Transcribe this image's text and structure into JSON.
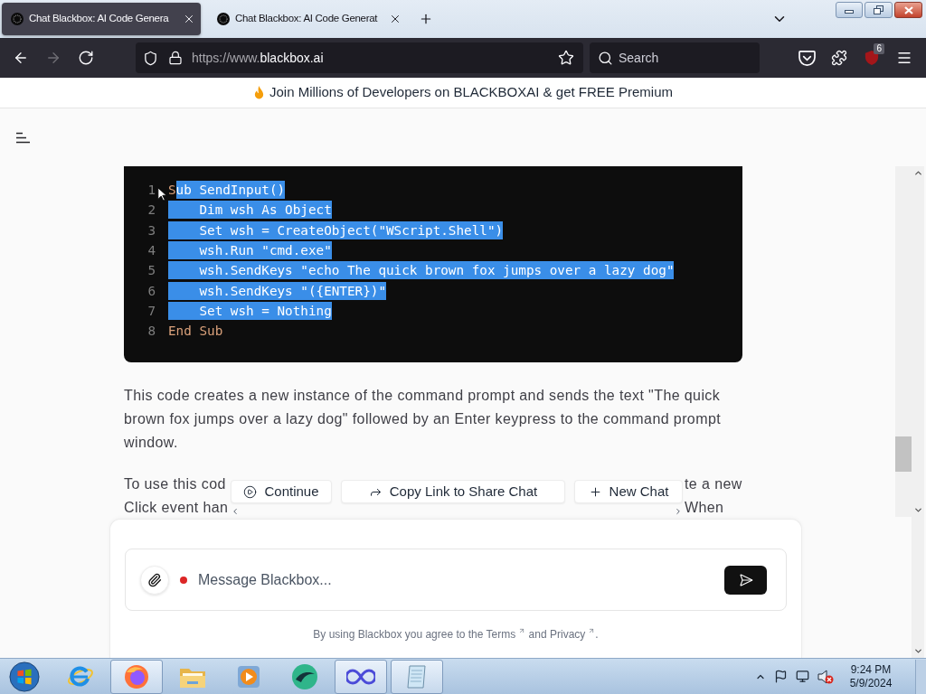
{
  "browser": {
    "tabs": [
      {
        "title": "Chat Blackbox: AI Code Genera",
        "selected": true
      },
      {
        "title": "Chat Blackbox: AI Code Generat",
        "selected": false
      }
    ],
    "nav": [
      {
        "kind": "back",
        "disabled": false
      },
      {
        "kind": "forward",
        "disabled": true
      },
      {
        "kind": "reload",
        "disabled": false
      }
    ],
    "address": {
      "prefix": "https://www.",
      "host": "blackbox.ai"
    },
    "search": {
      "placeholder": "Search"
    },
    "extension_badge": "6"
  },
  "banner": {
    "text": "Join Millions of Developers on BLACKBOXAI & get FREE Premium"
  },
  "code_block": {
    "lines": [
      {
        "number": "1",
        "segments": [
          {
            "text": "S",
            "selected": false,
            "kind": "keyword"
          },
          {
            "text": "ub SendInput()",
            "selected": true
          }
        ]
      },
      {
        "number": "2",
        "segments": [
          {
            "text": "    Dim wsh As Object",
            "selected": true
          }
        ]
      },
      {
        "number": "3",
        "segments": [
          {
            "text": "    Set wsh = CreateObject(\"WScript.Shell\")",
            "selected": true
          }
        ]
      },
      {
        "number": "4",
        "segments": [
          {
            "text": "    wsh.Run \"cmd.exe\"",
            "selected": true
          }
        ]
      },
      {
        "number": "5",
        "segments": [
          {
            "text": "    wsh.SendKeys \"echo The quick brown fox jumps over a lazy dog\"",
            "selected": true
          }
        ]
      },
      {
        "number": "6",
        "segments": [
          {
            "text": "    wsh.SendKeys \"({ENTER})\"",
            "selected": true
          }
        ]
      },
      {
        "number": "7",
        "segments": [
          {
            "text": "    Set wsh = Nothing",
            "selected": true
          }
        ]
      },
      {
        "number": "8",
        "segments": [
          {
            "text": "End Sub",
            "selected": false,
            "kind": "keyword"
          }
        ]
      }
    ]
  },
  "answer": {
    "paragraph": "This code creates a new instance of the command prompt and sends the text \"The quick brown fox jumps over a lazy dog\" followed by an Enter keypress to the command prompt window.",
    "partial_lines": [
      {
        "left": "To use this cod",
        "right": "te a new"
      },
      {
        "left": "Click event han",
        "right": "When"
      }
    ]
  },
  "actions": [
    {
      "kind": "continue",
      "label": "Continue"
    },
    {
      "kind": "share",
      "label": "Copy Link to Share Chat"
    },
    {
      "kind": "new",
      "label": "New Chat"
    }
  ],
  "composer": {
    "placeholder": "Message Blackbox..."
  },
  "legal": [
    {
      "kind": "text",
      "text": "By using Blackbox you agree to the"
    },
    {
      "kind": "link",
      "text": "Terms"
    },
    {
      "kind": "text",
      "text": "and"
    },
    {
      "kind": "link",
      "text": "Privacy"
    },
    {
      "kind": "text",
      "text": "."
    }
  ],
  "taskbar": {
    "apps": [
      {
        "kind": "e",
        "active": false
      },
      {
        "kind": "fox",
        "active": true
      },
      {
        "kind": "folder",
        "active": false
      },
      {
        "kind": "player",
        "active": false
      },
      {
        "kind": "sphere",
        "active": false
      },
      {
        "kind": "loop",
        "active": true
      },
      {
        "kind": "notepad",
        "active": true
      }
    ],
    "clock": {
      "time": "9:24 PM",
      "date": "5/9/2024"
    }
  }
}
